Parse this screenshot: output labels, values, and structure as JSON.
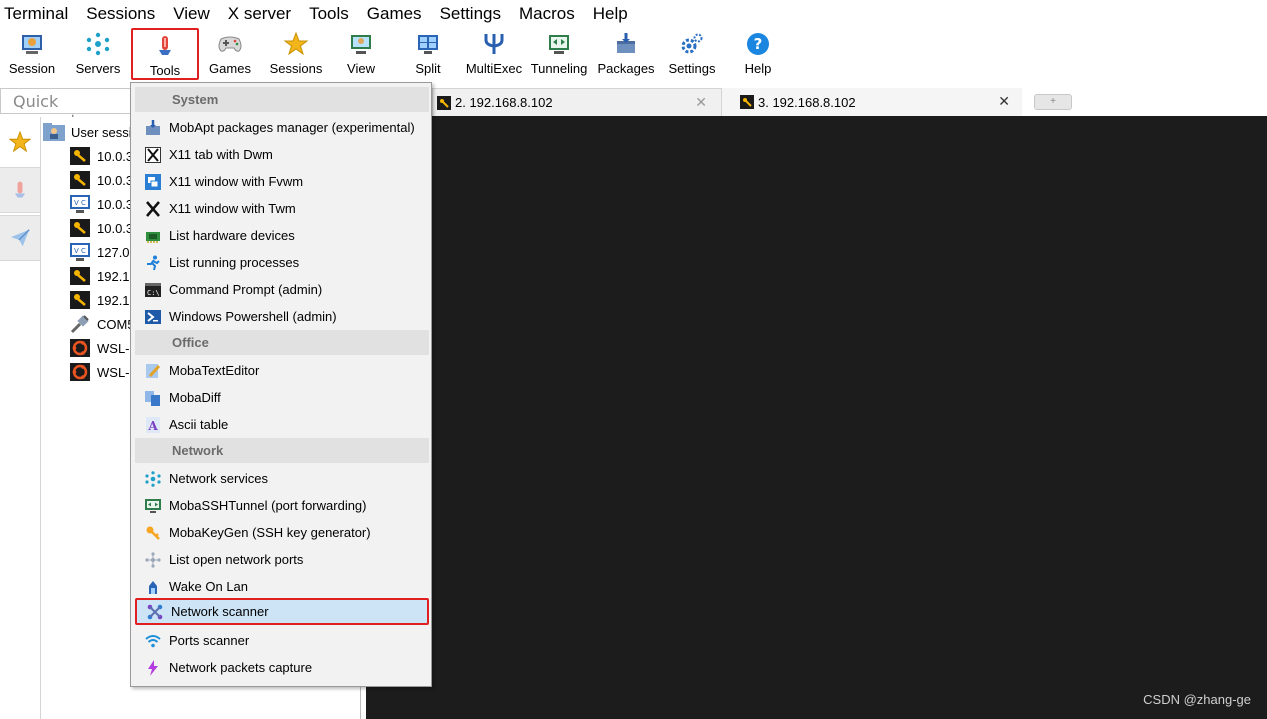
{
  "menubar": [
    "Terminal",
    "Sessions",
    "View",
    "X server",
    "Tools",
    "Games",
    "Settings",
    "Macros",
    "Help"
  ],
  "toolbar": {
    "session": "Session",
    "servers": "Servers",
    "tools": "Tools",
    "games": "Games",
    "sessions": "Sessions",
    "view": "View",
    "split": "Split",
    "multiexec": "MultiExec",
    "tunneling": "Tunneling",
    "packages": "Packages",
    "settings": "Settings",
    "help": "Help"
  },
  "quick_connect": {
    "placeholder": "Quick connect..."
  },
  "sessions_tree": {
    "root": "User sessi",
    "items": [
      "10.0.3",
      "10.0.3",
      "10.0.3",
      "10.0.3",
      "127.0",
      "192.1",
      "192.1",
      "COM5",
      "WSL-",
      "WSL-"
    ]
  },
  "tabs": [
    {
      "label": "2. 192.168.8.102",
      "close": "✕"
    },
    {
      "label": "3. 192.168.8.102",
      "close": "✕"
    }
  ],
  "new_tab": "+",
  "tools_menu": {
    "system": {
      "header": "System",
      "items": [
        "MobApt packages manager (experimental)",
        "X11 tab with Dwm",
        "X11 window with Fvwm",
        "X11 window with Twm",
        "List hardware devices",
        "List running processes",
        "Command Prompt (admin)",
        "Windows Powershell (admin)"
      ]
    },
    "office": {
      "header": "Office",
      "items": [
        "MobaTextEditor",
        "MobaDiff",
        "Ascii table"
      ]
    },
    "network": {
      "header": "Network",
      "items": [
        "Network services",
        "MobaSSHTunnel (port forwarding)",
        "MobaKeyGen (SSH key generator)",
        "List open network ports",
        "Wake On Lan",
        "Network scanner",
        "Ports scanner",
        "Network packets capture"
      ]
    }
  },
  "watermark": "CSDN @zhang-ge",
  "colors": {
    "highlight_border": "#e02020",
    "terminal_bg": "#1c1c1c",
    "menu_highlight": "#cde4f7"
  }
}
